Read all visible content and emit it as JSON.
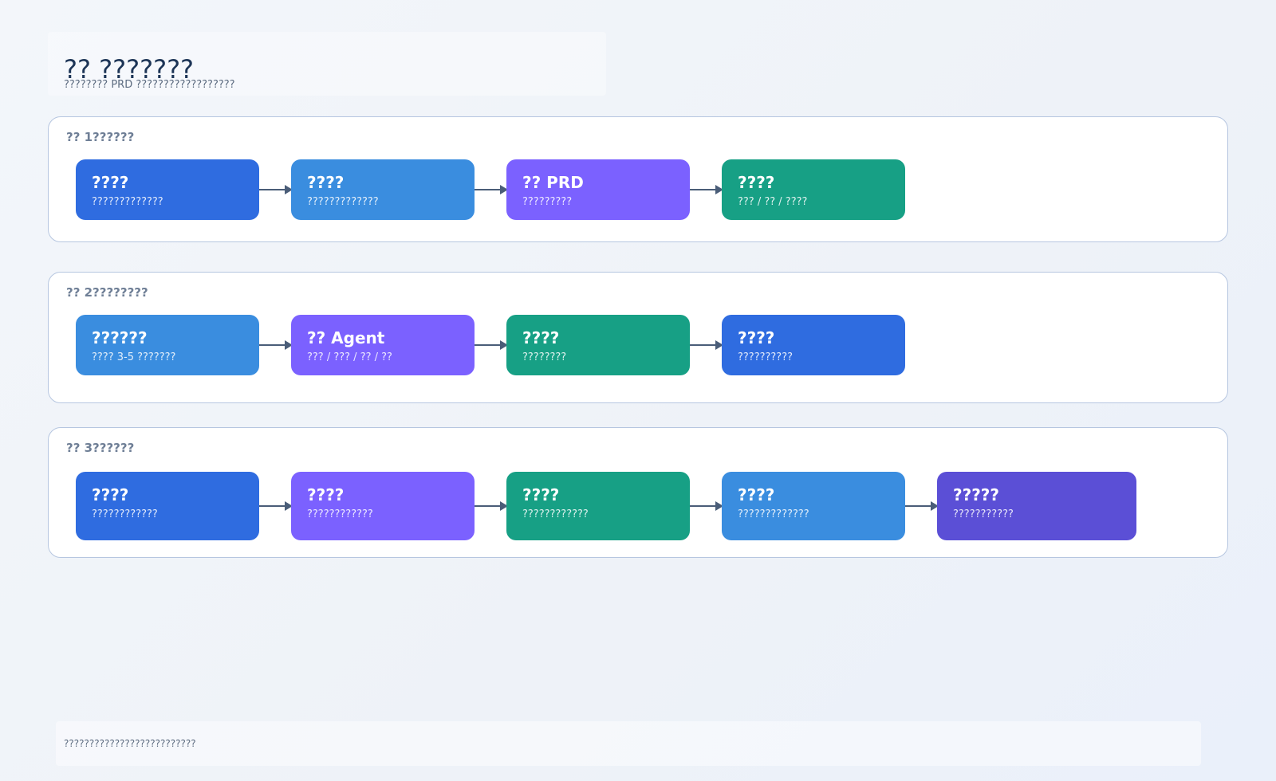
{
  "header": {
    "title": "?? ???????",
    "subtitle": "???????? PRD ??????????????????"
  },
  "colors": {
    "royal_blue": "#2f6ce0",
    "sky_blue": "#3a8ddf",
    "violet": "#7b61ff",
    "teal": "#17a085",
    "indigo": "#5b4fd6",
    "arrow": "#4a5d78",
    "lane_border": "#b6c6e0"
  },
  "lanes": [
    {
      "title": "?? 1??????",
      "nodes": [
        {
          "title": "????",
          "subtitle": "?????????????",
          "color": "royal_blue"
        },
        {
          "title": "????",
          "subtitle": "?????????????",
          "color": "sky_blue"
        },
        {
          "title": "?? PRD",
          "subtitle": "?????????",
          "color": "violet"
        },
        {
          "title": "????",
          "subtitle": "??? / ?? / ????",
          "color": "teal"
        }
      ]
    },
    {
      "title": "?? 2????????",
      "nodes": [
        {
          "title": "??????",
          "subtitle": "???? 3-5 ???????",
          "color": "sky_blue"
        },
        {
          "title": "?? Agent",
          "subtitle": "??? / ??? / ?? / ??",
          "color": "violet"
        },
        {
          "title": "????",
          "subtitle": "????????",
          "color": "teal"
        },
        {
          "title": "????",
          "subtitle": "??????????",
          "color": "royal_blue"
        }
      ]
    },
    {
      "title": "?? 3??????",
      "nodes": [
        {
          "title": "????",
          "subtitle": "????????????",
          "color": "royal_blue"
        },
        {
          "title": "????",
          "subtitle": "????????????",
          "color": "violet"
        },
        {
          "title": "????",
          "subtitle": "????????????",
          "color": "teal"
        },
        {
          "title": "????",
          "subtitle": "?????????????",
          "color": "sky_blue"
        },
        {
          "title": "?????",
          "subtitle": "???????????",
          "color": "indigo"
        }
      ]
    }
  ],
  "footer": {
    "note": "??????????????????????????"
  }
}
